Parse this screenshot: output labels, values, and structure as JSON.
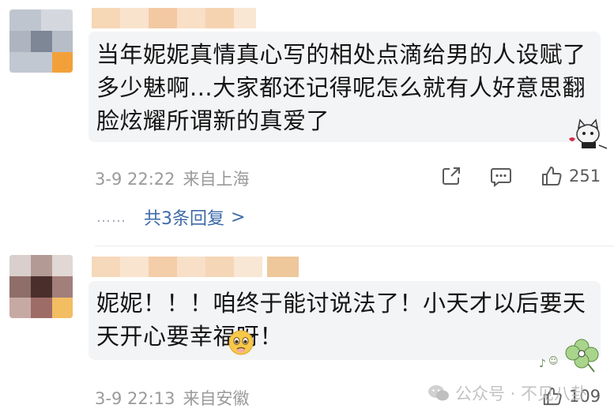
{
  "comments": [
    {
      "text": "当年妮妮真情真心写的相处点滴给男的人设赋了多少魅啊...大家都还记得呢怎么就有人好意思翻脸炫耀所谓新的真爱了",
      "time": "3-9 22:22",
      "location": "来自上海",
      "likes": "251",
      "replies_label": "共3条回复",
      "replies_dots": "……",
      "sticker_icon": "cat-sticker-icon"
    },
    {
      "text": "妮妮！！！咱终于能讨说法了！小天才以后要天天开心要幸福呀！",
      "time": "3-9 22:13",
      "location": "来自安徽",
      "likes": "109",
      "emoji_icon": "pleading-face-icon",
      "sticker_icon": "clover-sticker-icon"
    }
  ],
  "watermark": {
    "text": "公众号 · 不见八卦"
  },
  "colors": {
    "meta": "#9a9a9a",
    "link": "#3d6aa8",
    "bubble": "#f3f4f6"
  }
}
